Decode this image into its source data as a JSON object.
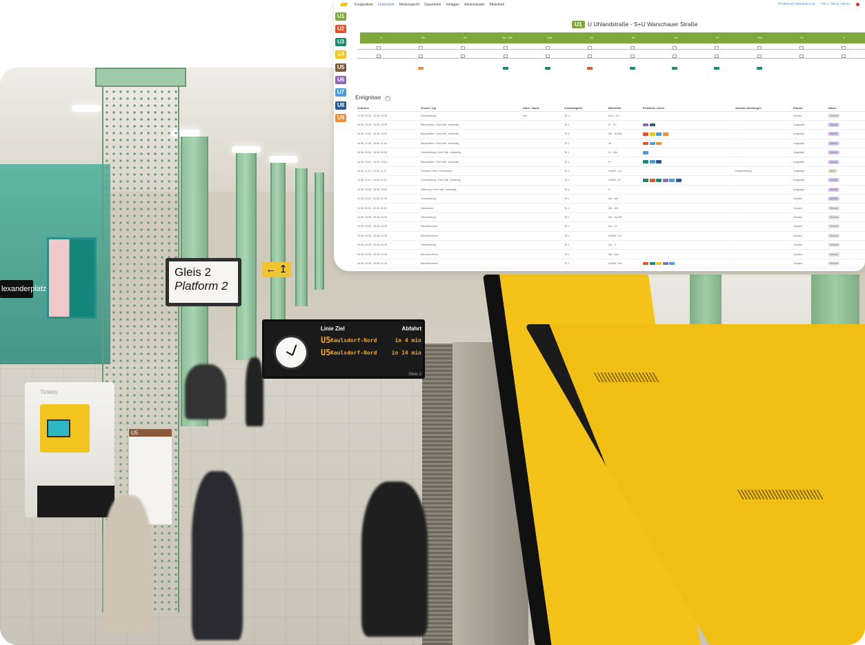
{
  "photo": {
    "station_sign": "lexanderplatz",
    "gleis_sign": {
      "line1": "Gleis 2",
      "line2": "Platform 2"
    },
    "arrow_sign": "← ↥",
    "departure_board": {
      "header": {
        "col1": "Linie Ziel",
        "col2": "Abfahrt"
      },
      "rows": [
        {
          "line": "U5",
          "destination": "Kaulsdorf-Nord",
          "time": "in 4 min"
        },
        {
          "line": "U5",
          "destination": "Kaulsdorf-Nord",
          "time": "in 14 min"
        }
      ],
      "footer": "Gleis 2"
    },
    "ticket_machine_label": "Tickets",
    "line_plan_header": "U5"
  },
  "app": {
    "nav": [
      "Ereignisliste",
      "Liniensicht",
      "Meldungsicht",
      "Dauertests",
      "Vorlagen",
      "Administrator",
      "Bibliothek"
    ],
    "nav_active_index": 1,
    "nav_right": [
      "FAHRGAST, BAHN & S.-B.",
      "TW 1, TW 11, TW 14"
    ],
    "lines": [
      {
        "label": "U1",
        "color": "#7da83d"
      },
      {
        "label": "U2",
        "color": "#e2542d"
      },
      {
        "label": "U3",
        "color": "#1a8a6a"
      },
      {
        "label": "U4",
        "color": "#f2c41d"
      },
      {
        "label": "U5",
        "color": "#7f5b3d"
      },
      {
        "label": "U6",
        "color": "#8c6ab8"
      },
      {
        "label": "U7",
        "color": "#4c9ed9"
      },
      {
        "label": "U8",
        "color": "#2a5a91"
      },
      {
        "label": "U9",
        "color": "#f08c35"
      }
    ],
    "line_title": {
      "badge": "U1",
      "text": "U Uhlandstraße - S+U Warschauer Straße"
    },
    "stations": [
      "U",
      "Kfu",
      "Wi",
      "Nu / Wit",
      "Gnd",
      "Gu",
      "Mo",
      "Ha",
      "Pr",
      "Kbo",
      "Gr",
      "S"
    ],
    "events_title": "Ereignisse",
    "table": {
      "headers": [
        "Zeitraum",
        "Grund / Typ",
        "Dane / Name",
        "Zuständigkeit",
        "Bahnhöfe",
        "Erwartete Linien",
        "Aktuelle Meldungen",
        "Planart",
        "Status"
      ],
      "rows": [
        {
          "time": "17.06, 00:30 - 24.06, 01:30",
          "reason": "Veranstaltung",
          "name": "test",
          "resp": "TA 1",
          "stations": "Kruz - Gu",
          "chips": [],
          "msg": "-",
          "plan": "Geplant",
          "status": "Entwurf"
        },
        {
          "time": "16.06, 12:30 - 16.06, 12:59",
          "reason": "Bauarbeiten / Kein Halt - beidseitig",
          "name": "",
          "resp": "TA 1",
          "stations": "Pr - Gr",
          "chips": [
            "#8c6ab8",
            "#2a5a91"
          ],
          "msg": "-",
          "plan": "Ungeplant",
          "status": "Aktuell"
        },
        {
          "time": "16.06, 12:02 - 16.06, 12:02",
          "reason": "Bauarbeiten / Kein Halt - beidseitig",
          "name": "",
          "resp": "TA 1",
          "stations": "Wri - Nu/Wit",
          "chips": [
            "#e2542d",
            "#f2c41d",
            "#4c9ed9",
            "#f08c35"
          ],
          "msg": "-",
          "plan": "Ungeplant",
          "status": "Aktuell"
        },
        {
          "time": "16.06, 11:36 - 16.06, 11:36",
          "reason": "Bauarbeiten / Kein Halt - beidseitig",
          "name": "",
          "resp": "TA 1",
          "stations": "Wi",
          "chips": [
            "#e2542d",
            "#4c9ed9",
            "#f08c35"
          ],
          "msg": "-",
          "plan": "Ungeplant",
          "status": "Aktuell"
        },
        {
          "time": "16.06, 09:40 - 16.06, 09:40",
          "reason": "Veranstaltung / Kein Halt - beidseitig",
          "name": "",
          "resp": "TA 1",
          "stations": "Gr - Wa",
          "chips": [
            "#4c9ed9"
          ],
          "msg": "-",
          "plan": "Ungeplant",
          "status": "Aktuell"
        },
        {
          "time": "15.06, 13:01 - 15.06, 13:01",
          "reason": "Bauarbeiten / Kein Halt - beidseitig",
          "name": "",
          "resp": "TA 1",
          "stations": "Pr",
          "chips": [
            "#1a8a6a",
            "#4c9ed9",
            "#2a5a91"
          ],
          "msg": "-",
          "plan": "Ungeplant",
          "status": "Aktuell"
        },
        {
          "time": "15.06, 11:17 - 15.06, 11:17",
          "reason": "Fremdes Gleis / Servicefahrt",
          "name": "",
          "resp": "TA 1",
          "stations": "Nu/Wit - Gu",
          "chips": [],
          "msg": "Hauptmeldung",
          "plan": "Ungeplant",
          "status": "Aktiv"
        },
        {
          "time": "15.06, 11:13 - 16.06, 11:13",
          "reason": "Veranstaltung / Kein Halt - beidseitig",
          "name": "",
          "resp": "TA 1",
          "stations": "Nu/Wit - Pr",
          "chips": [
            "#1a8a6a",
            "#e2542d",
            "#1a8a6a",
            "#8c6ab8",
            "#4c9ed9",
            "#2a5a91"
          ],
          "msg": "-",
          "plan": "Ungeplant",
          "status": "Aktuell"
        },
        {
          "time": "15.06, 10:05 - 16.06, 10:05",
          "reason": "Witterung / Kein Halt - beidseitig",
          "name": "",
          "resp": "TA 1",
          "stations": "S",
          "chips": [],
          "msg": "-",
          "plan": "Ungeplant",
          "status": "Aktuell"
        },
        {
          "time": "11.06, 00:30 - 26.06, 01:30",
          "reason": "Veranstaltung",
          "name": "",
          "resp": "TA 1",
          "stations": "Wri - Wo",
          "chips": [],
          "msg": "-",
          "plan": "Geplant",
          "status": "Aktuell"
        },
        {
          "time": "11.06, 00:30 - 26.06, 01:30",
          "reason": "Information",
          "name": "",
          "resp": "TA 1",
          "stations": "Wri - Wo",
          "chips": [],
          "msg": "-",
          "plan": "Geplant",
          "status": "Entwurf"
        },
        {
          "time": "10.06, 00:30 - 25.06, 01:30",
          "reason": "Veranstaltung",
          "name": "",
          "resp": "TA 1",
          "stations": "Wri - Nu/Wit",
          "chips": [],
          "msg": "-",
          "plan": "Geplant",
          "status": "Entwurf"
        },
        {
          "time": "10.06, 00:30 - 25.06, 01:30",
          "reason": "Baumaßnahme",
          "name": "",
          "resp": "TA 1",
          "stations": "Mo - Gr",
          "chips": [],
          "msg": "-",
          "plan": "Geplant",
          "status": "Entwurf"
        },
        {
          "time": "10.06, 00:30 - 25.06, 01:30",
          "reason": "Baumaßnahme",
          "name": "",
          "resp": "TA 1",
          "stations": "Nu/Wit - Ho",
          "chips": [],
          "msg": "-",
          "plan": "Geplant",
          "status": "Entwurf"
        },
        {
          "time": "10.06, 00:30 - 25.06, 00:30",
          "reason": "Veranstaltung",
          "name": "",
          "resp": "TA 1",
          "stations": "Wri - S",
          "chips": [],
          "msg": "-",
          "plan": "Geplant",
          "status": "Entwurf"
        },
        {
          "time": "09.06, 00:30 - 24.06, 01:30",
          "reason": "Baumaßnahme",
          "name": "",
          "resp": "TA 1",
          "stations": "Wri - Kbo",
          "chips": [],
          "msg": "-",
          "plan": "Geplant",
          "status": "Entwurf"
        },
        {
          "time": "09.06, 00:30 - 24.06, 01:30",
          "reason": "Baumaßnahme",
          "name": "",
          "resp": "TA 1",
          "stations": "Nu/Wit - Wo",
          "chips": [
            "#e2542d",
            "#1a8a6a",
            "#f2c41d",
            "#8c6ab8",
            "#4c9ed9"
          ],
          "msg": "-",
          "plan": "Geplant",
          "status": "Entwurf"
        }
      ]
    },
    "status_colors": {
      "Aktuell": "#d9c4ef",
      "Entwurf": "#e6e6e6",
      "Aktiv": "#d6efc8"
    }
  }
}
